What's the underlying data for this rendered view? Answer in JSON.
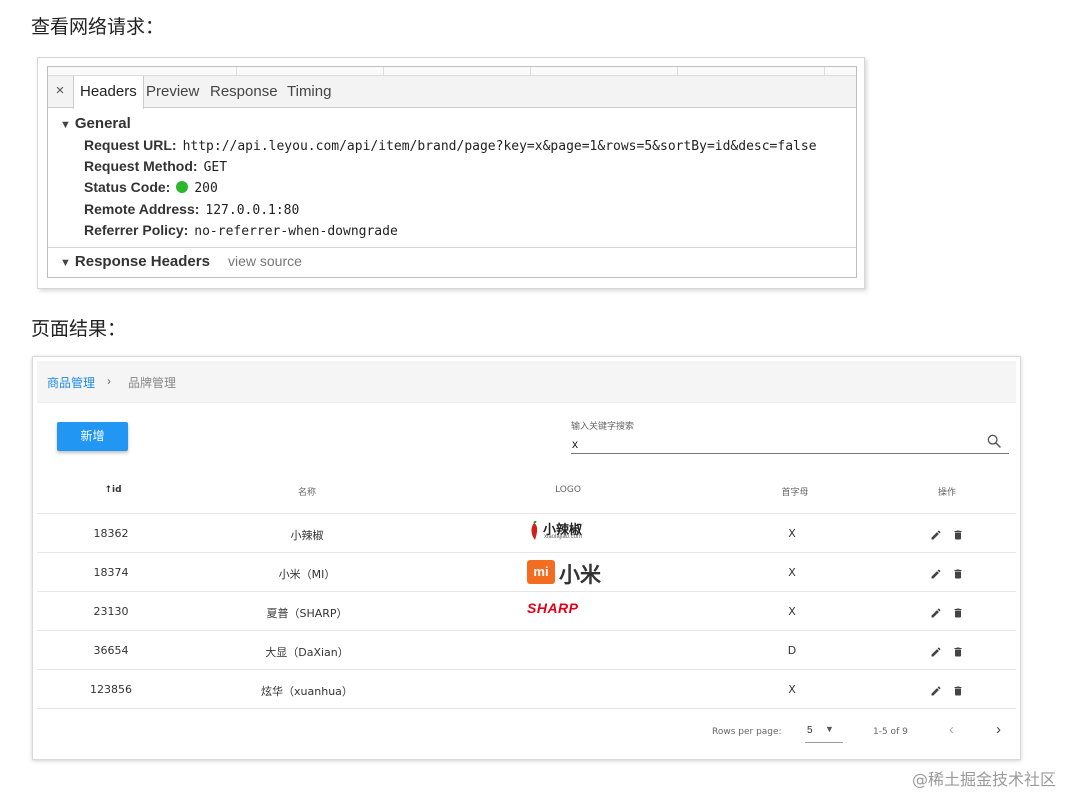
{
  "headings": {
    "network": "查看网络请求：",
    "result": "页面结果："
  },
  "devtools": {
    "tabs": [
      "Headers",
      "Preview",
      "Response",
      "Timing"
    ],
    "close": "×",
    "general_title": "General",
    "rows": [
      {
        "key": "Request URL:",
        "value": "http://api.leyou.com/api/item/brand/page?key=x&page=1&rows=5&sortBy=id&desc=false"
      },
      {
        "key": "Request Method:",
        "value": "GET"
      },
      {
        "key": "Status Code:",
        "value": "200"
      },
      {
        "key": "Remote Address:",
        "value": "127.0.0.1:80"
      },
      {
        "key": "Referrer Policy:",
        "value": "no-referrer-when-downgrade"
      }
    ],
    "response_headers_title": "Response Headers",
    "view_source": "view source",
    "status_color": "#2db52d"
  },
  "admin": {
    "breadcrumb": {
      "parent": "商品管理",
      "separator": "›",
      "current": "品牌管理"
    },
    "add_button": "新增",
    "search": {
      "label": "输入关键字搜索",
      "value": "x"
    },
    "columns": {
      "id": "id",
      "name": "名称",
      "logo": "LOGO",
      "letter": "首字母",
      "action": "操作"
    },
    "sort_icon": "arrow-up-icon",
    "rows": [
      {
        "id": "18362",
        "name": "小辣椒",
        "letter": "X",
        "logo_text": "小辣椒",
        "logo_sub": "xiaolajiao.com"
      },
      {
        "id": "18374",
        "name": "小米（MI）",
        "letter": "X",
        "logo_text": "小米",
        "logo_badge": "mi"
      },
      {
        "id": "23130",
        "name": "夏普（SHARP）",
        "letter": "X",
        "logo_text": "SHARP"
      },
      {
        "id": "36654",
        "name": "大显（DaXian）",
        "letter": "D"
      },
      {
        "id": "123856",
        "name": "炫华（xuanhua）",
        "letter": "X"
      }
    ],
    "pagination": {
      "rows_per_page_label": "Rows per page:",
      "rows_per_page": "5",
      "range": "1-5 of 9"
    },
    "accent_color": "#2196f3"
  },
  "watermark": "@稀土掘金技术社区"
}
